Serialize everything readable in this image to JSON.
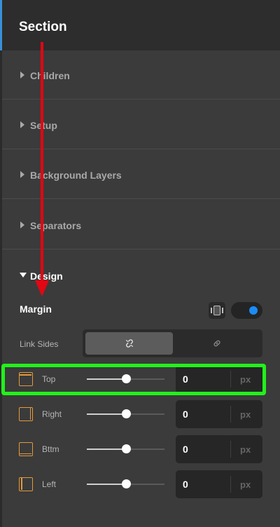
{
  "header": {
    "title": "Section"
  },
  "sections": [
    {
      "label": "Children"
    },
    {
      "label": "Setup"
    },
    {
      "label": "Background Layers"
    },
    {
      "label": "Separators"
    }
  ],
  "design": {
    "label": "Design",
    "margin": {
      "label": "Margin",
      "responsive_icon": "device-toggle-icon",
      "toggle_on": true,
      "link_sides": {
        "label": "Link Sides",
        "options": [
          {
            "icon": "link-broken-icon",
            "active": true
          },
          {
            "icon": "link-icon",
            "active": false
          }
        ]
      },
      "sides": [
        {
          "label": "Top",
          "value": "0",
          "unit": "px",
          "slider_value": 0.5,
          "highlighted": true
        },
        {
          "label": "Right",
          "value": "0",
          "unit": "px",
          "slider_value": 0.5
        },
        {
          "label": "Bttm",
          "value": "0",
          "unit": "px",
          "slider_value": 0.5
        },
        {
          "label": "Left",
          "value": "0",
          "unit": "px",
          "slider_value": 0.5
        }
      ]
    }
  },
  "colors": {
    "accent": "#1b8cf5",
    "side_icon": "#e29a3b",
    "annotation_arrow": "#e30613",
    "annotation_box": "#21f21a"
  }
}
